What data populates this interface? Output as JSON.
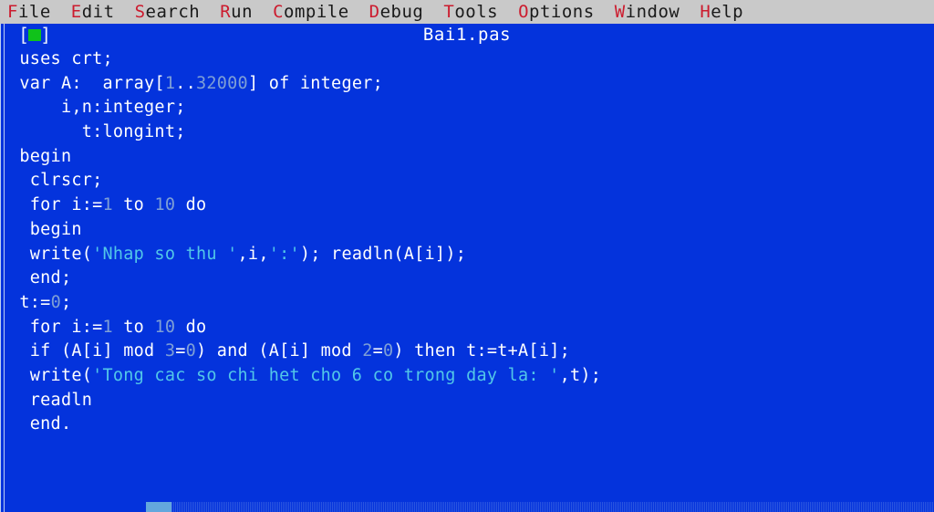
{
  "menubar": {
    "items": [
      {
        "name": "file",
        "hotkey": "F",
        "rest": "ile"
      },
      {
        "name": "edit",
        "hotkey": "E",
        "rest": "dit"
      },
      {
        "name": "search",
        "hotkey": "S",
        "rest": "earch"
      },
      {
        "name": "run",
        "hotkey": "R",
        "rest": "un"
      },
      {
        "name": "compile",
        "hotkey": "C",
        "rest": "ompile"
      },
      {
        "name": "debug",
        "hotkey": "D",
        "rest": "ebug"
      },
      {
        "name": "tools",
        "hotkey": "T",
        "rest": "ools"
      },
      {
        "name": "options",
        "hotkey": "O",
        "rest": "ptions"
      },
      {
        "name": "window",
        "hotkey": "W",
        "rest": "indow"
      },
      {
        "name": "help",
        "hotkey": "H",
        "rest": "elp"
      }
    ]
  },
  "window": {
    "title": "Bai1.pas",
    "close_widget": "[ ]"
  },
  "colors": {
    "editor_background": "#0433dc",
    "menubar_background": "#c9c9c9",
    "hotkey": "#cc1b2e",
    "code_text": "#ffffff",
    "number_literal": "#7e9fd6",
    "string_literal": "#52c7e8",
    "close_square": "#10c21a",
    "scrollbar_thumb": "#63a7dd"
  },
  "code": {
    "lines": [
      {
        "segs": [
          {
            "t": " uses crt;",
            "c": "plain"
          }
        ]
      },
      {
        "segs": [
          {
            "t": " var A:  array[",
            "c": "plain"
          },
          {
            "t": "1",
            "c": "num"
          },
          {
            "t": "..",
            "c": "plain"
          },
          {
            "t": "32000",
            "c": "num"
          },
          {
            "t": "] of integer;",
            "c": "plain"
          }
        ]
      },
      {
        "segs": [
          {
            "t": "     i,n:integer;",
            "c": "plain"
          }
        ]
      },
      {
        "segs": [
          {
            "t": "       t:longint;",
            "c": "plain"
          }
        ]
      },
      {
        "segs": [
          {
            "t": " begin",
            "c": "plain"
          }
        ]
      },
      {
        "segs": [
          {
            "t": "  clrscr;",
            "c": "plain"
          }
        ]
      },
      {
        "segs": [
          {
            "t": "  for i:=",
            "c": "plain"
          },
          {
            "t": "1",
            "c": "num"
          },
          {
            "t": " to ",
            "c": "plain"
          },
          {
            "t": "10",
            "c": "num"
          },
          {
            "t": " do",
            "c": "plain"
          }
        ]
      },
      {
        "segs": [
          {
            "t": "  begin",
            "c": "plain"
          }
        ]
      },
      {
        "segs": [
          {
            "t": "  write(",
            "c": "plain"
          },
          {
            "t": "'Nhap so thu '",
            "c": "str"
          },
          {
            "t": ",i,",
            "c": "plain"
          },
          {
            "t": "':'",
            "c": "str"
          },
          {
            "t": "); readln(A[i]);",
            "c": "plain"
          }
        ]
      },
      {
        "segs": [
          {
            "t": "  end;",
            "c": "plain"
          }
        ]
      },
      {
        "segs": [
          {
            "t": " t:=",
            "c": "plain"
          },
          {
            "t": "0",
            "c": "num"
          },
          {
            "t": ";",
            "c": "plain"
          }
        ]
      },
      {
        "segs": [
          {
            "t": "  for i:=",
            "c": "plain"
          },
          {
            "t": "1",
            "c": "num"
          },
          {
            "t": " to ",
            "c": "plain"
          },
          {
            "t": "10",
            "c": "num"
          },
          {
            "t": " do",
            "c": "plain"
          }
        ]
      },
      {
        "segs": [
          {
            "t": "  if (A[i] mod ",
            "c": "plain"
          },
          {
            "t": "3",
            "c": "num"
          },
          {
            "t": "=",
            "c": "plain"
          },
          {
            "t": "0",
            "c": "num"
          },
          {
            "t": ") and (A[i] mod ",
            "c": "plain"
          },
          {
            "t": "2",
            "c": "num"
          },
          {
            "t": "=",
            "c": "plain"
          },
          {
            "t": "0",
            "c": "num"
          },
          {
            "t": ") then t:=t+A[i];",
            "c": "plain"
          }
        ]
      },
      {
        "segs": [
          {
            "t": "  write(",
            "c": "plain"
          },
          {
            "t": "'Tong cac so chi het cho 6 co trong day la: '",
            "c": "str"
          },
          {
            "t": ",t);",
            "c": "plain"
          }
        ]
      },
      {
        "segs": [
          {
            "t": "  readln",
            "c": "plain"
          }
        ]
      },
      {
        "segs": [
          {
            "t": "  end.",
            "c": "plain"
          }
        ]
      }
    ]
  }
}
